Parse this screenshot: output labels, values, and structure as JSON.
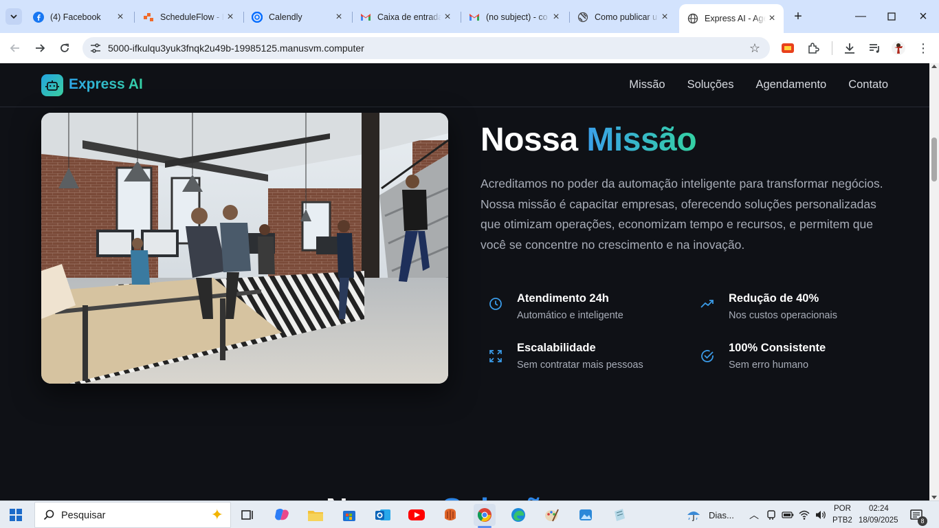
{
  "browser": {
    "tabs": [
      {
        "title": "(4) Facebook",
        "icon": "facebook-icon"
      },
      {
        "title": "ScheduleFlow - I",
        "icon": "scheduleflow-icon"
      },
      {
        "title": "Calendly",
        "icon": "calendly-icon"
      },
      {
        "title": "Caixa de entrada",
        "icon": "gmail-icon"
      },
      {
        "title": "(no subject) - co",
        "icon": "gmail-icon"
      },
      {
        "title": "Como publicar u",
        "icon": "generic-site-icon"
      },
      {
        "title": "Express AI - Age",
        "icon": "globe-icon"
      }
    ],
    "url": "5000-ifkulqu3yuk3fnqk2u49b-19985125.manusvm.computer"
  },
  "site": {
    "brand": "Express AI",
    "nav": [
      "Missão",
      "Soluções",
      "Agendamento",
      "Contato"
    ],
    "mission": {
      "title_plain": "Nossa",
      "title_accent": "Missão",
      "body": "Acreditamos no poder da automação inteligente para transformar negócios. Nossa missão é capacitar empresas, oferecendo soluções personalizadas que otimizam operações, economizam tempo e recursos, e permitem que você se concentre no crescimento e na inovação.",
      "features": [
        {
          "title": "Atendimento 24h",
          "subtitle": "Automático e inteligente",
          "icon": "clock-icon"
        },
        {
          "title": "Redução de 40%",
          "subtitle": "Nos custos operacionais",
          "icon": "trending-up-icon"
        },
        {
          "title": "Escalabilidade",
          "subtitle": "Sem contratar mais pessoas",
          "icon": "expand-icon"
        },
        {
          "title": "100% Consistente",
          "subtitle": "Sem erro humano",
          "icon": "check-circle-icon"
        }
      ]
    },
    "next_section": {
      "title_plain": "Nossas",
      "title_accent": "Soluções"
    }
  },
  "colors": {
    "accent_blue": "#3aa0ea",
    "accent_green": "#34d1a3",
    "page_bg": "#0f1116"
  },
  "taskbar": {
    "search_placeholder": "Pesquisar",
    "weather": "Dias...",
    "language": "POR",
    "layout": "PTB2",
    "time": "02:24",
    "date": "18/09/2025",
    "notifications": "8"
  }
}
